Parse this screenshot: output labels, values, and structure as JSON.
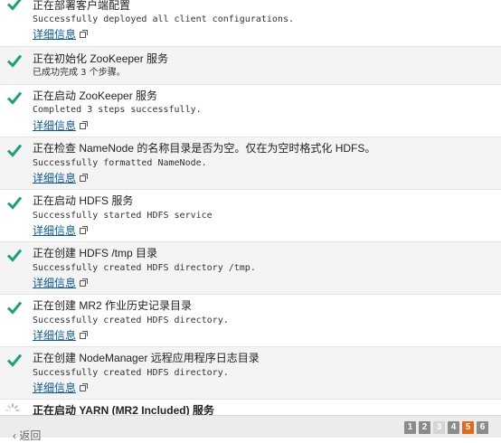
{
  "steps": [
    {
      "title": "正在部署客户端配置",
      "message": "Successfully deployed all client configurations.",
      "link": "详细信息"
    },
    {
      "title": "正在初始化 ZooKeeper 服务",
      "message": "已成功完成 3 个步骤。",
      "link": ""
    },
    {
      "title": "正在启动 ZooKeeper 服务",
      "message": "Completed 3 steps successfully.",
      "link": "详细信息"
    },
    {
      "title": "正在检查 NameNode 的名称目录是否为空。仅在为空时格式化 HDFS。",
      "message": "Successfully formatted NameNode.",
      "link": "详细信息"
    },
    {
      "title": "正在启动 HDFS 服务",
      "message": "Successfully started HDFS service",
      "link": "详细信息"
    },
    {
      "title": "正在创建 HDFS /tmp 目录",
      "message": "Successfully created HDFS directory /tmp.",
      "link": "详细信息"
    },
    {
      "title": "正在创建 MR2 作业历史记录目录",
      "message": "Successfully created HDFS directory.",
      "link": "详细信息"
    },
    {
      "title": "正在创建 NodeManager 远程应用程序日志目录",
      "message": "Successfully created HDFS directory.",
      "link": "详细信息"
    }
  ],
  "running_step": {
    "title": "正在启动 YARN (MR2 Included) 服务"
  },
  "footer": {
    "back_label": "返回",
    "pages": [
      "1",
      "2",
      "3",
      "4",
      "5",
      "6"
    ],
    "current_page": "5"
  },
  "colors": {
    "check": "#1aa37a",
    "link": "#0c5a9c",
    "current_page": "#e36a1a"
  }
}
